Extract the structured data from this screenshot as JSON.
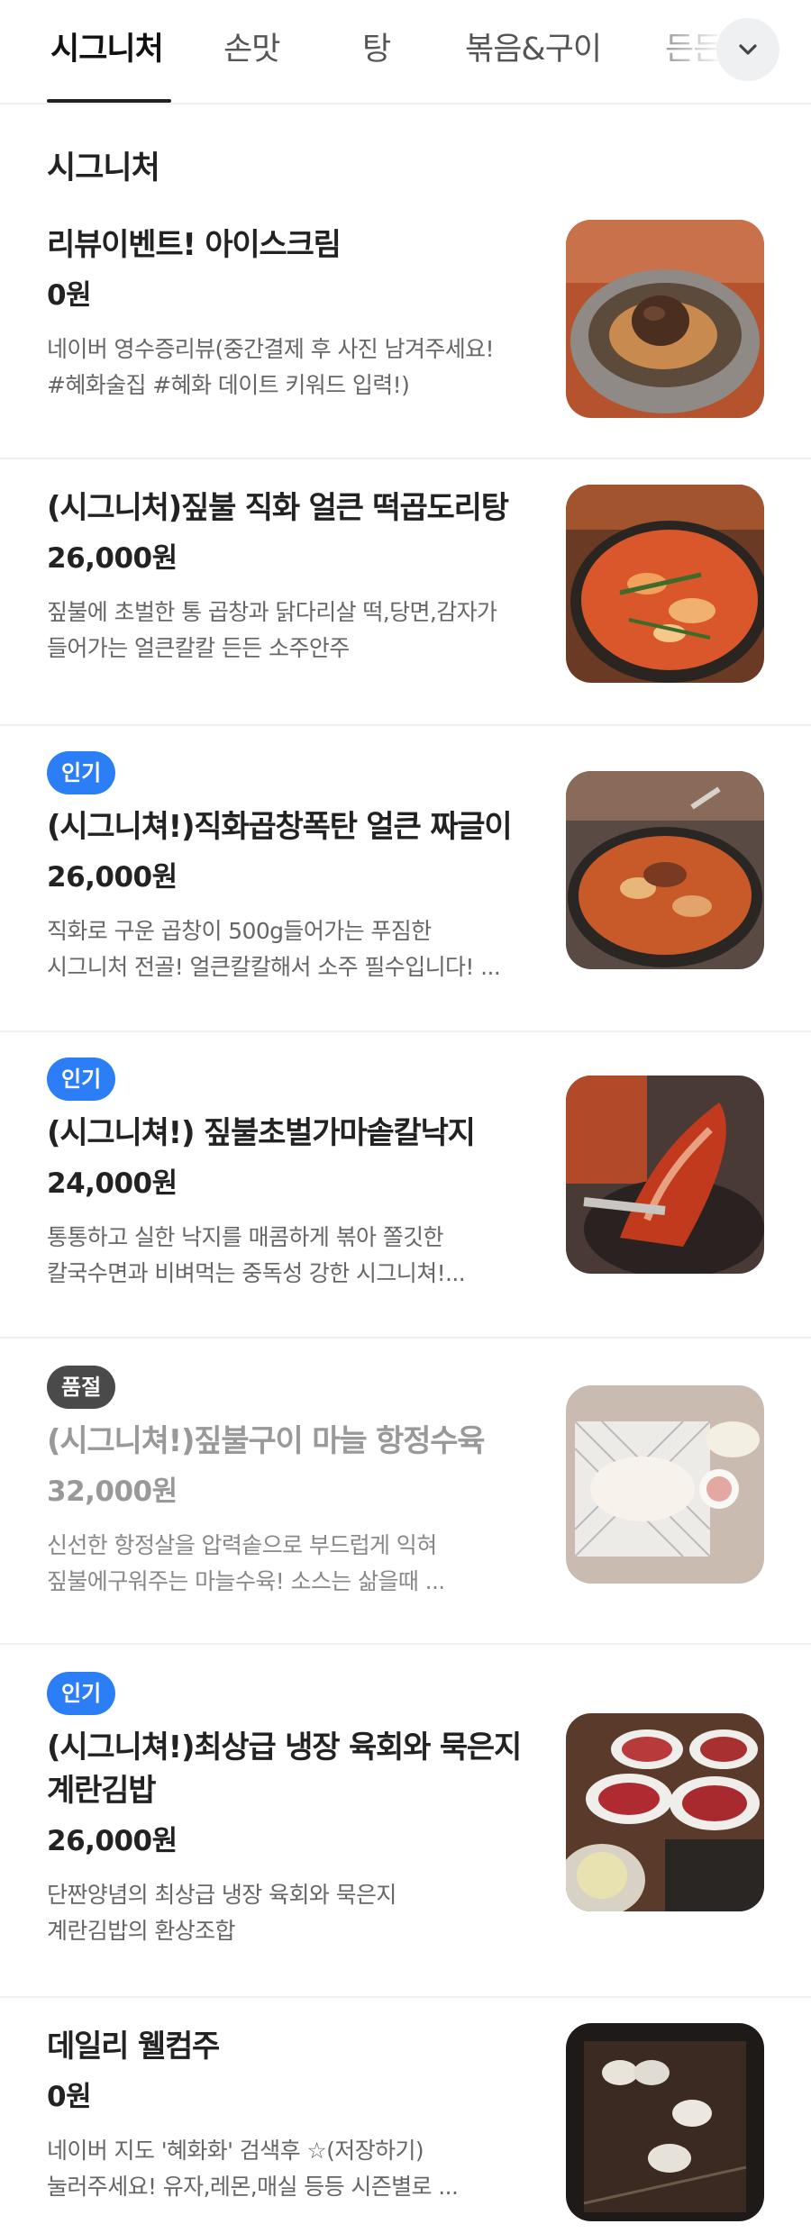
{
  "tabs": [
    {
      "label": "시그니처",
      "active": true
    },
    {
      "label": "손맛",
      "active": false
    },
    {
      "label": "탕",
      "active": false
    },
    {
      "label": "볶음&구이",
      "active": false
    },
    {
      "label": "든든",
      "active": false
    }
  ],
  "section_title": "시그니처",
  "items": [
    {
      "badge": "",
      "name": [
        "리뷰이벤트! 아이스크림"
      ],
      "price": "0원",
      "desc": [
        "네이버 영수증리뷰(중간결제 후 사진 남겨주세요!",
        "#혜화술집 #혜화 데이트 키워드 입력!)"
      ],
      "image": "ice-cream-photo"
    },
    {
      "badge": "",
      "name": [
        "(시그니처)짚불 직화 얼큰 떡곱도리탕"
      ],
      "price": "26,000원",
      "desc": [
        "짚불에 초벌한 통 곱창과 닭다리살 떡,당면,감자가",
        "들어가는 얼큰칼칼 든든 소주안주"
      ],
      "image": "tteok-gop-dori-tang-photo"
    },
    {
      "badge": "인기",
      "name": [
        "(시그니쳐!)직화곱창폭탄 얼큰 짜글이"
      ],
      "price": "26,000원",
      "desc": [
        "직화로 구운 곱창이 500g들어가는 푸짐한",
        "시그니처 전골! 얼큰칼칼해서 소주 필수입니다! ..."
      ],
      "image": "gopchang-jjageuli-photo"
    },
    {
      "badge": "인기",
      "name": [
        "(시그니쳐!) 짚불초벌가마솥칼낙지"
      ],
      "price": "24,000원",
      "desc": [
        "통통하고 실한 낙지를 매콤하게 볶아 쫄깃한",
        "칼국수면과 비벼먹는 중독성 강한 시그니쳐!..."
      ],
      "image": "nakji-photo"
    },
    {
      "badge": "품절",
      "name": [
        "(시그니쳐!)짚불구이 마늘 항정수육"
      ],
      "price": "32,000원",
      "desc": [
        "신선한  항정살을 압력솥으로 부드럽게 익혀",
        "짚불에구워주는 마늘수육! 소스는 삶을때 ..."
      ],
      "image": "hangjeong-suyuk-photo",
      "sold_out": true
    },
    {
      "badge": "인기",
      "name": [
        "(시그니쳐!)최상급 냉장 육회와 묵은지",
        "계란김밥"
      ],
      "price": "26,000원",
      "desc": [
        "단짠양념의 최상급 냉장 육회와 묵은지",
        "계란김밥의 환상조합"
      ],
      "image": "yukhoe-gimbap-photo"
    },
    {
      "badge": "",
      "name": [
        "데일리 웰컴주"
      ],
      "price": "0원",
      "desc": [
        "네이버 지도 '혜화화' 검색후 ☆(저장하기)",
        "눌러주세요! 유자,레몬,매실 등등 시즌별로 ..."
      ],
      "image": "welcome-drink-photo"
    }
  ],
  "colors": {
    "popular_badge": "#2b7ef5",
    "soldout_badge": "#4a4a4a",
    "active_tab": "#111111"
  }
}
